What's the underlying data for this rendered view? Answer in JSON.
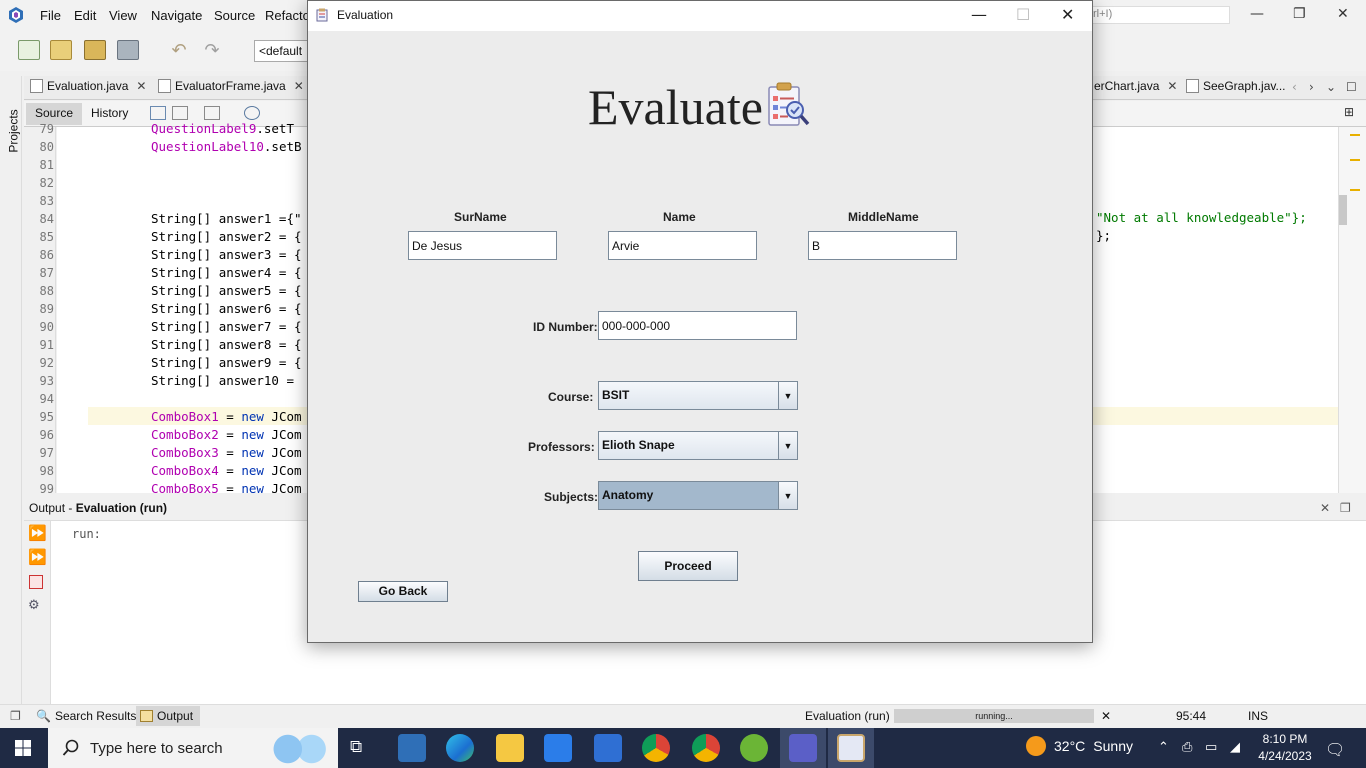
{
  "ide": {
    "menu": [
      "File",
      "Edit",
      "View",
      "Navigate",
      "Source",
      "Refactor"
    ],
    "search_partial": "rl+I)",
    "config_selector": "<default",
    "projects_label": "Projects",
    "file_tabs": [
      {
        "label": "Evaluation.java"
      },
      {
        "label": "EvaluatorFrame.java"
      },
      {
        "label": "erChart.java"
      },
      {
        "label": "SeeGraph.jav..."
      }
    ],
    "editor_tabs": {
      "source": "Source",
      "history": "History"
    },
    "code_lines": [
      {
        "n": "79",
        "text": "QuestionLabel9.setT"
      },
      {
        "n": "80",
        "text": "QuestionLabel10.setB"
      },
      {
        "n": "81",
        "text": ""
      },
      {
        "n": "82",
        "text": ""
      },
      {
        "n": "83",
        "text": ""
      },
      {
        "n": "84",
        "text": "String[] answer1 ={\""
      },
      {
        "n": "85",
        "text": "String[] answer2 = {"
      },
      {
        "n": "86",
        "text": "String[] answer3 = {"
      },
      {
        "n": "87",
        "text": "String[] answer4 = {"
      },
      {
        "n": "88",
        "text": "String[] answer5 = {"
      },
      {
        "n": "89",
        "text": "String[] answer6 = {"
      },
      {
        "n": "90",
        "text": "String[] answer7 = {"
      },
      {
        "n": "91",
        "text": "String[] answer8 = {"
      },
      {
        "n": "92",
        "text": "String[] answer9 = {"
      },
      {
        "n": "93",
        "text": "String[] answer10 = "
      },
      {
        "n": "94",
        "text": ""
      },
      {
        "n": "95",
        "var": "ComboBox1",
        "rest": " = ",
        "kw": "new",
        "tail": " JCom"
      },
      {
        "n": "96",
        "var": "ComboBox2",
        "rest": " = ",
        "kw": "new",
        "tail": " JCom"
      },
      {
        "n": "97",
        "var": "ComboBox3",
        "rest": " = ",
        "kw": "new",
        "tail": " JCom"
      },
      {
        "n": "98",
        "var": "ComboBox4",
        "rest": " = ",
        "kw": "new",
        "tail": " JCom"
      },
      {
        "n": "99",
        "var": "ComboBox5",
        "rest": " = ",
        "kw": "new",
        "tail": " JCom"
      }
    ],
    "code_right_84": "\"Not at all knowledgeable\"};",
    "code_right_85": "};",
    "output": {
      "prefix": "Output - ",
      "name": "Evaluation (run)",
      "text": "run:"
    },
    "statusbar": {
      "search_results": "Search Results",
      "output": "Output",
      "task": "Evaluation (run)",
      "progress": "running...",
      "position": "95:44",
      "mode": "INS"
    }
  },
  "dialog": {
    "title": "Evaluation",
    "heading": "Evaluate",
    "surname": {
      "label": "SurName",
      "value": "De Jesus"
    },
    "name": {
      "label": "Name",
      "value": "Arvie"
    },
    "middlename": {
      "label": "MiddleName",
      "value": "B"
    },
    "id_number": {
      "label": "ID Number:",
      "value": "000-000-000"
    },
    "course": {
      "label": "Course:",
      "value": "BSIT"
    },
    "professors": {
      "label": "Professors:",
      "value": "Elioth Snape"
    },
    "subjects": {
      "label": "Subjects:",
      "value": "Anatomy"
    },
    "proceed_label": "Proceed",
    "go_back_label": "Go Back"
  },
  "taskbar": {
    "search_placeholder": "Type here to search",
    "weather_temp": "32°C",
    "weather_desc": "Sunny",
    "time": "8:10 PM",
    "date": "4/24/2023"
  },
  "colors": {
    "selected_combo": "#a3b8cc",
    "taskbar": "#1f2a44",
    "code_keyword": "#0033b3",
    "code_field": "#b000b0",
    "code_string": "#007a00"
  }
}
